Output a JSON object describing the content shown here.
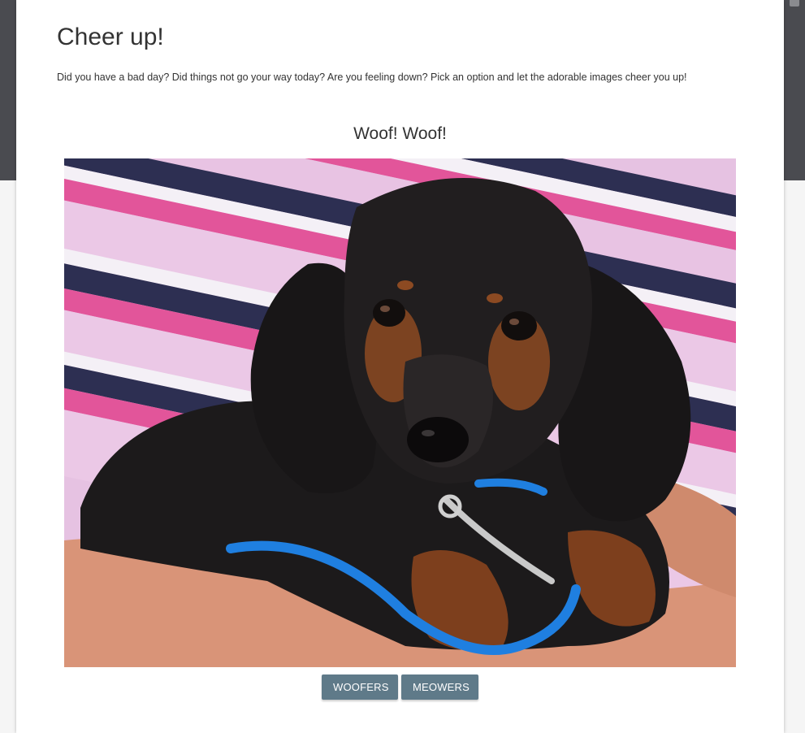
{
  "page": {
    "title": "Cheer up!",
    "intro": "Did you have a bad day? Did things not go your way today? Are you feeling down? Pick an option and let the adorable images cheer you up!",
    "subtitle": "Woof! Woof!"
  },
  "image": {
    "subject": "black and tan dachshund puppy held in arms",
    "description": "Puppy with blue leash resting on a person's arm, pink and navy striped shirt in background"
  },
  "buttons": {
    "woofers_label": "WOOFERS",
    "meowers_label": "MEOWERS"
  },
  "colors": {
    "background_band": "#4a4b50",
    "card": "#ffffff",
    "button": "#5f7a89",
    "text": "#333333"
  }
}
